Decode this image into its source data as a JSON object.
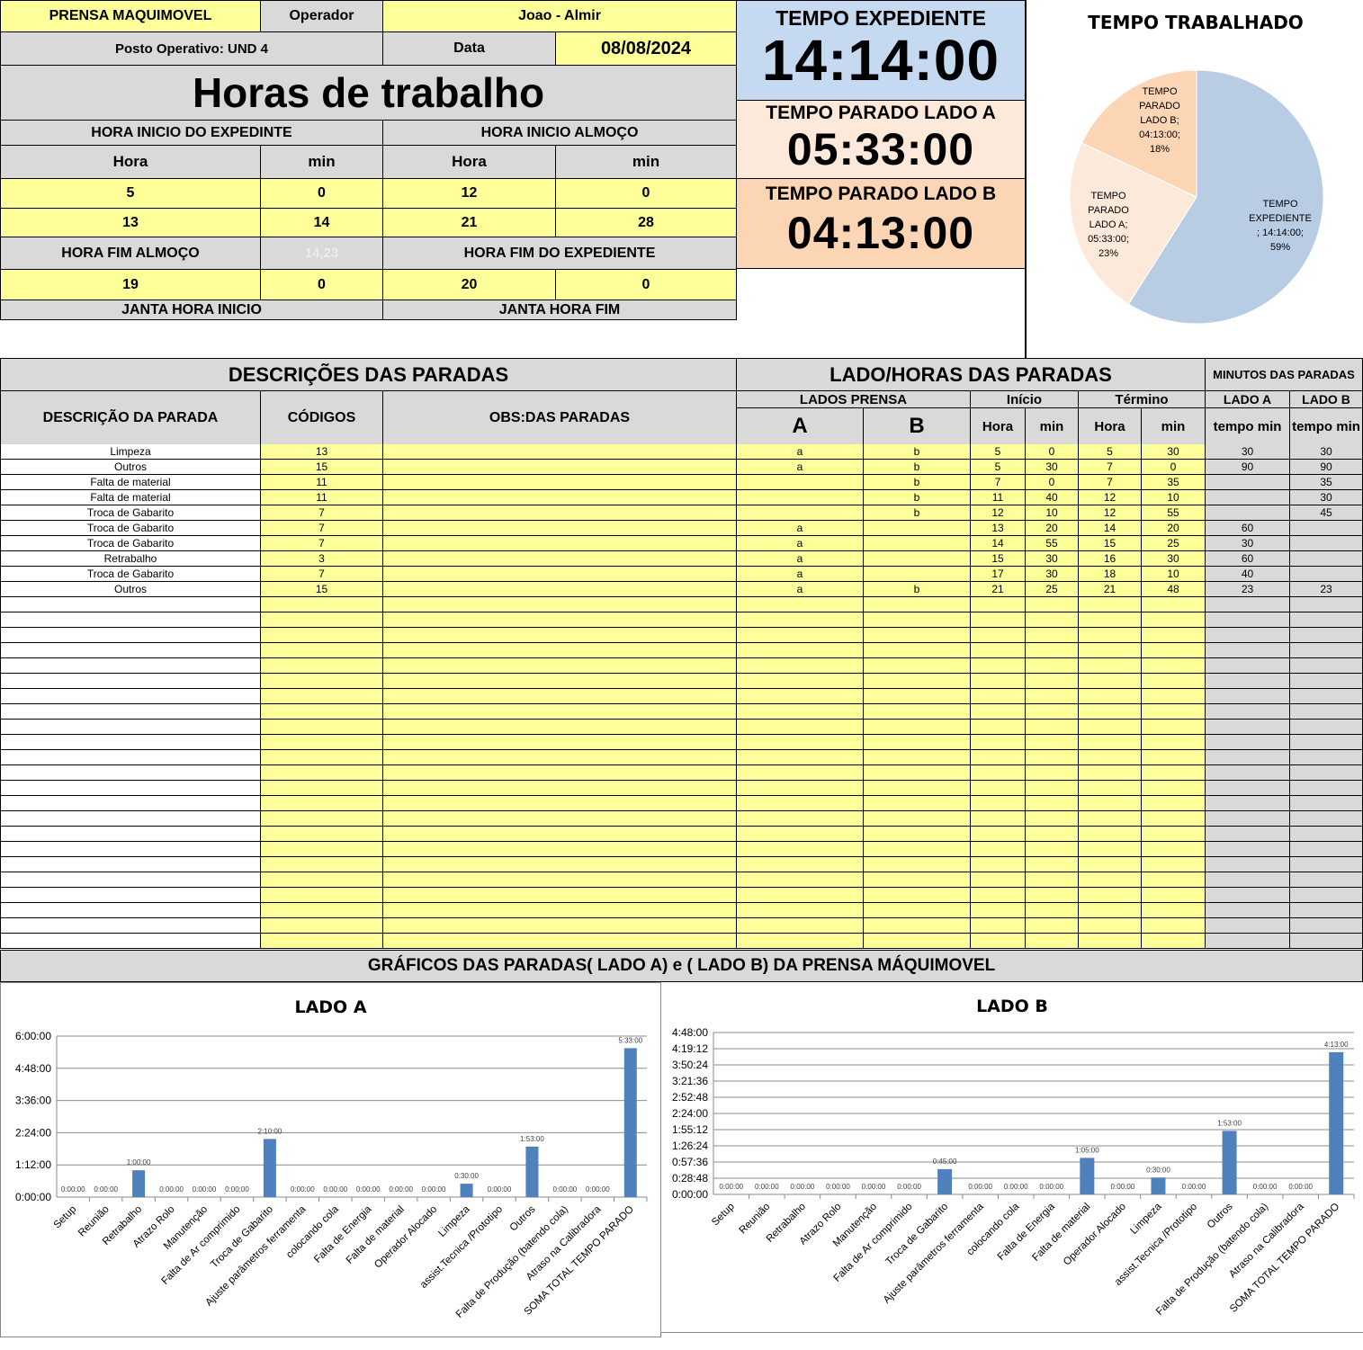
{
  "header": {
    "machine": "PRENSA MAQUIMOVEL",
    "operator_label": "Operador",
    "operator": "Joao - Almir",
    "posto": "Posto Operativo: UND 4",
    "date_label": "Data",
    "date": "08/08/2024",
    "title": "Horas de trabalho"
  },
  "shift": {
    "inicio_expediente_label": "HORA INICIO DO EXPEDINTE",
    "inicio_almoco_label": "HORA INICIO ALMOÇO",
    "hora_label": "Hora",
    "min_label": "min",
    "row1": [
      "5",
      "0",
      "12",
      "0"
    ],
    "row2": [
      "13",
      "14",
      "21",
      "28"
    ],
    "fim_almoco_label": "HORA FIM ALMOÇO",
    "faded_value": "14,23",
    "fim_expediente_label": "HORA FIM DO EXPEDIENTE",
    "row3": [
      "19",
      "0",
      "20",
      "0"
    ],
    "janta_inicio_label": "JANTA HORA INICIO",
    "janta_fim_label": "JANTA HORA FIM"
  },
  "totals": {
    "expediente_label": "TEMPO EXPEDIENTE",
    "expediente": "14:14:00",
    "lado_a_label": "TEMPO PARADO LADO A",
    "lado_a": "05:33:00",
    "lado_b_label": "TEMPO PARADO LADO B",
    "lado_b": "04:13:00"
  },
  "pie": {
    "title": "TEMPO TRABALHADO",
    "slices": [
      {
        "label": [
          "TEMPO",
          "EXPEDIENTE",
          "; 14:14:00;",
          "59%"
        ],
        "value": 59,
        "color": "#b8cce4"
      },
      {
        "label": [
          "TEMPO",
          "PARADO",
          "LADO A;",
          "05:33:00;",
          "23%"
        ],
        "value": 23,
        "color": "#fde9d9"
      },
      {
        "label": [
          "TEMPO",
          "PARADO",
          "LADO B;",
          "04:13:00;",
          "18%"
        ],
        "value": 18,
        "color": "#fcd5b4"
      }
    ]
  },
  "table": {
    "desc_title": "DESCRIÇÕES DAS PARADAS",
    "lado_title": "LADO/HORAS DAS PARADAS",
    "minutos_title": "MINUTOS DAS PARADAS",
    "col_desc": "DESCRIÇÃO DA PARADA",
    "col_codigos": "CÓDIGOS",
    "col_obs": "OBS:DAS PARADAS",
    "lados_prensa": "LADOS PRENSA",
    "inicio": "Início",
    "termino": "Término",
    "lado_a": "LADO A",
    "lado_b": "LADO B",
    "a": "A",
    "b": "B",
    "hora": "Hora",
    "min": "min",
    "tempo_min": "tempo min",
    "rows": [
      [
        "Limpeza",
        "13",
        "",
        "a",
        "b",
        "5",
        "0",
        "5",
        "30",
        "30",
        "30"
      ],
      [
        "Outros",
        "15",
        "",
        "a",
        "b",
        "5",
        "30",
        "7",
        "0",
        "90",
        "90"
      ],
      [
        "Falta de material",
        "11",
        "",
        "",
        "b",
        "7",
        "0",
        "7",
        "35",
        "",
        "35"
      ],
      [
        "Falta de material",
        "11",
        "",
        "",
        "b",
        "11",
        "40",
        "12",
        "10",
        "",
        "30"
      ],
      [
        "Troca de Gabarito",
        "7",
        "",
        "",
        "b",
        "12",
        "10",
        "12",
        "55",
        "",
        "45"
      ],
      [
        "Troca de Gabarito",
        "7",
        "",
        "a",
        "",
        "13",
        "20",
        "14",
        "20",
        "60",
        ""
      ],
      [
        "Troca de Gabarito",
        "7",
        "",
        "a",
        "",
        "14",
        "55",
        "15",
        "25",
        "30",
        ""
      ],
      [
        "Retrabalho",
        "3",
        "",
        "a",
        "",
        "15",
        "30",
        "16",
        "30",
        "60",
        ""
      ],
      [
        "Troca de Gabarito",
        "7",
        "",
        "a",
        "",
        "17",
        "30",
        "18",
        "10",
        "40",
        ""
      ],
      [
        "Outros",
        "15",
        "",
        "a",
        "b",
        "21",
        "25",
        "21",
        "48",
        "23",
        "23"
      ]
    ],
    "empty_rows": 23
  },
  "charts_banner": "GRÁFICOS DAS PARADAS( LADO A) e ( LADO B) DA PRENSA MÁQUIMOVEL",
  "chart_data": [
    {
      "type": "bar",
      "title": "LADO A",
      "categories": [
        "Setup",
        "Reunião",
        "Retrabalho",
        "Atrazo Rolo",
        "Manutenção",
        "Falta de Ar comprimido",
        "Troca de Gabarito",
        "Ajuste parâmetros ferramenta",
        "colocando cola",
        "Falta de Energia",
        "Falta de material",
        "Operador Alocado",
        "Limpeza",
        "assist.Tecnica /Prototipo",
        "Outros",
        "Falta de Produção (batendo cola)",
        "Atraso na Calibradora",
        "SOMA TOTAL TEMPO PARADO"
      ],
      "values": [
        0,
        0,
        60,
        0,
        0,
        0,
        130,
        0,
        0,
        0,
        0,
        0,
        30,
        0,
        113,
        0,
        0,
        333
      ],
      "data_labels": [
        "0:00:00",
        "0:00:00",
        "1:00:00",
        "0:00:00",
        "0:00:00",
        "0:00:00",
        "2:10:00",
        "0:00:00",
        "0:00:00",
        "0:00:00",
        "0:00:00",
        "0:00:00",
        "0:30:00",
        "0:00:00",
        "1:53:00",
        "0:00:00",
        "0:00:00",
        "5:33:00"
      ],
      "y_ticks": [
        "0:00:00",
        "1:12:00",
        "2:24:00",
        "3:36:00",
        "4:48:00",
        "6:00:00"
      ],
      "ylim": [
        0,
        360
      ],
      "tick_step": 72,
      "bar_color": "#4f81bd"
    },
    {
      "type": "bar",
      "title": "LADO B",
      "categories": [
        "Setup",
        "Reunião",
        "Retrabalho",
        "Atrazo Rolo",
        "Manutenção",
        "Falta de Ar comprimido",
        "Troca de Gabarito",
        "Ajuste parâmetros ferramenta",
        "colocando cola",
        "Falta de Energia",
        "Falta de material",
        "Operador Alocado",
        "Limpeza",
        "assist.Tecnica /Prototipo",
        "Outros",
        "Falta de Produção (batendo cola)",
        "Atraso na Calibradora",
        "SOMA TOTAL TEMPO PARADO"
      ],
      "values": [
        0,
        0,
        0,
        0,
        0,
        0,
        45,
        0,
        0,
        0,
        65,
        0,
        30,
        0,
        113,
        0,
        0,
        253
      ],
      "data_labels": [
        "0:00:00",
        "0:00:00",
        "0:00:00",
        "0:00:00",
        "0:00:00",
        "0:00:00",
        "0:45:00",
        "0:00:00",
        "0:00:00",
        "0:00:00",
        "1:05:00",
        "0:00:00",
        "0:30:00",
        "0:00:00",
        "1:53:00",
        "0:00:00",
        "0:00:00",
        "4:13:00"
      ],
      "y_ticks": [
        "0:00:00",
        "0:28:48",
        "0:57:36",
        "1:26:24",
        "1:55:12",
        "2:24:00",
        "2:52:48",
        "3:21:36",
        "3:50:24",
        "4:19:12",
        "4:48:00"
      ],
      "ylim": [
        0,
        288
      ],
      "tick_step": 28.8,
      "bar_color": "#4f81bd"
    }
  ]
}
